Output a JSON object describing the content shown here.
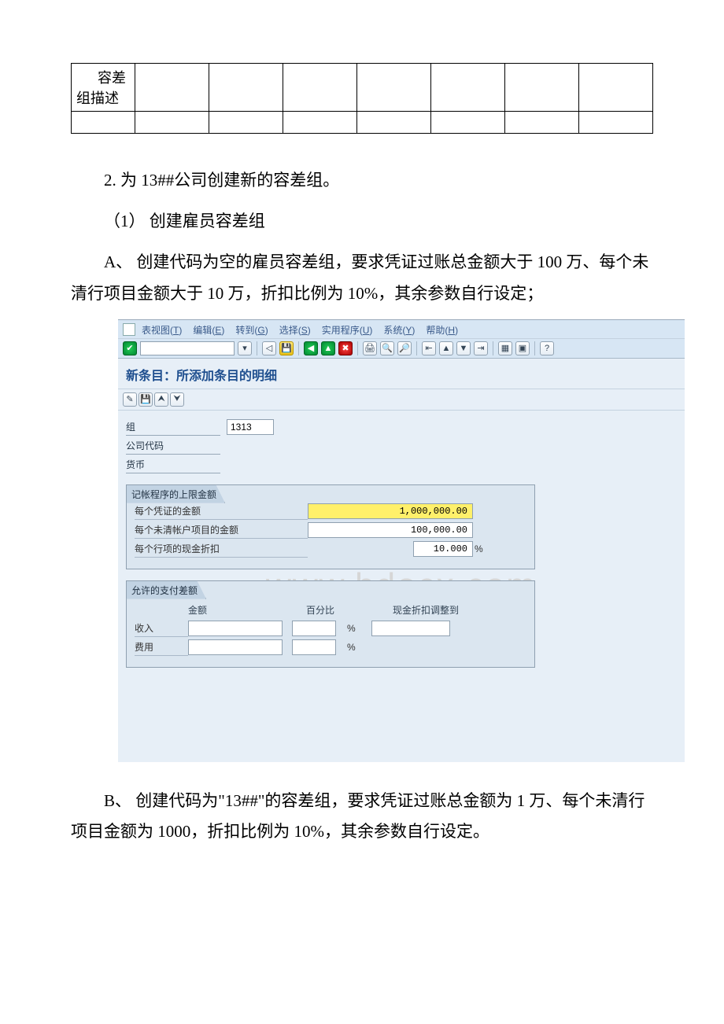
{
  "table": {
    "row1col1": "    容差组描述"
  },
  "p1": "2. 为 13##公司创建新的容差组。",
  "p2": "（1） 创建雇员容差组",
  "p3": "A、 创建代码为空的雇员容差组，要求凭证过账总金额大于 100 万、每个未清行项目金额大于 10 万，折扣比例为 10%，其余参数自行设定；",
  "p4": "B、 创建代码为\"13##\"的容差组，要求凭证过账总金额为 1 万、每个未清行项目金额为 1000，折扣比例为 10%，其余参数自行设定。",
  "sap": {
    "menu": {
      "m1": "表视图(",
      "m1a": "T",
      "m1b": ")",
      "m2": "编辑(",
      "m2a": "E",
      "m2b": ")",
      "m3": "转到(",
      "m3a": "G",
      "m3b": ")",
      "m4": "选择(",
      "m4a": "S",
      "m4b": ")",
      "m5": "实用程序(",
      "m5a": "U",
      "m5b": ")",
      "m6": "系统(",
      "m6a": "Y",
      "m6b": ")",
      "m7": "帮助(",
      "m7a": "H",
      "m7b": ")"
    },
    "title": "新条目：所添加条目的明细",
    "fields": {
      "group_label": "组",
      "group_value": "1313",
      "company_label": "公司代码",
      "currency_label": "货币"
    },
    "panel1": {
      "title": "记帐程序的上限金额",
      "r1": "每个凭证的金额",
      "r1v": "1,000,000.00",
      "r2": "每个未清帐户项目的金额",
      "r2v": "100,000.00",
      "r3": "每个行项的现金折扣",
      "r3v": "10.000",
      "pct": "%"
    },
    "panel2": {
      "title": "允许的支付差额",
      "h_amount": "金额",
      "h_pct": "百分比",
      "h_adj": "现金折扣调整到",
      "row_income": "收入",
      "row_expense": "费用",
      "pct": "%"
    }
  },
  "watermark": "www.bdocx.com"
}
